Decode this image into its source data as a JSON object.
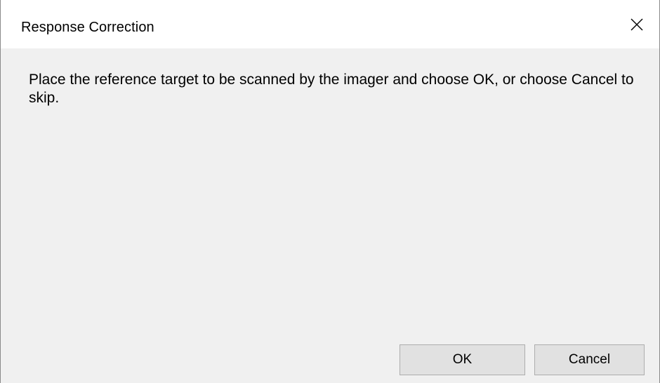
{
  "window": {
    "title": "Response Correction",
    "close_icon": "close-icon"
  },
  "body": {
    "message": "Place the reference target to be scanned by the imager and choose OK, or choose Cancel to skip."
  },
  "buttons": {
    "ok_label": "OK",
    "cancel_label": "Cancel"
  },
  "colors": {
    "titlebar": "#ffffff",
    "dialog_background": "#f0f0f0",
    "button_face": "#e1e1e1",
    "button_border": "#adadad"
  }
}
